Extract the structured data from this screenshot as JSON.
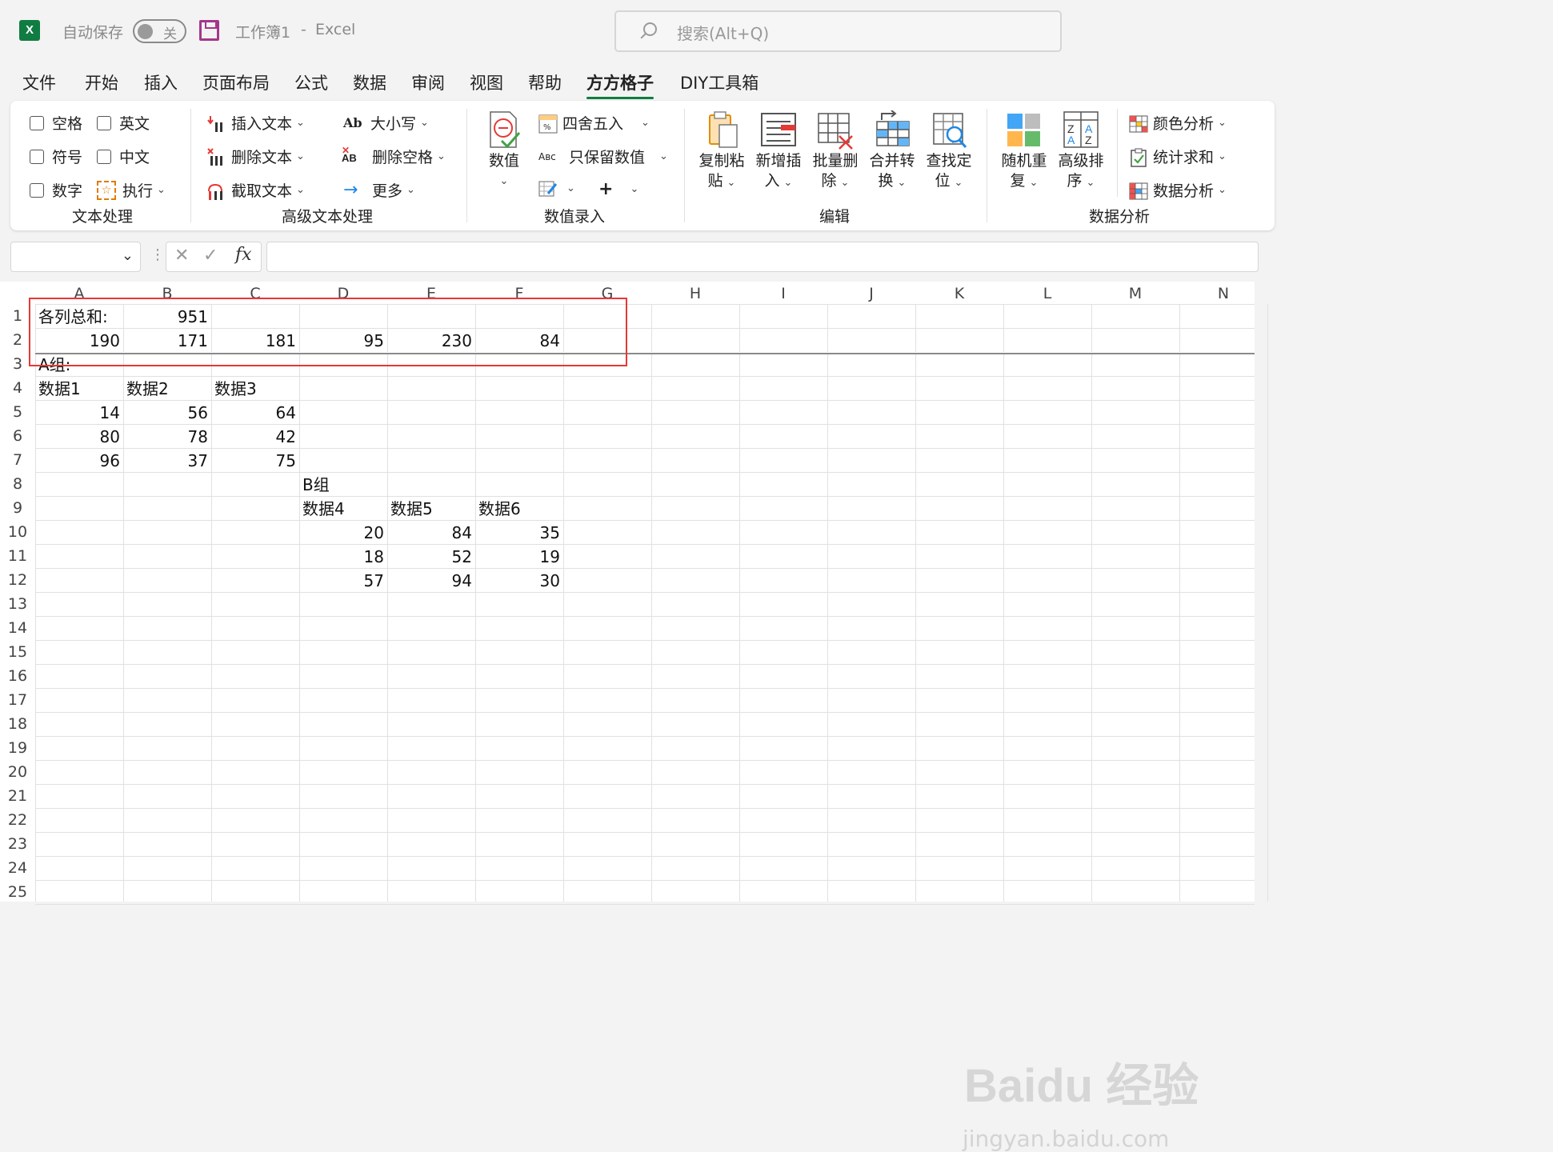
{
  "titlebar": {
    "autosave_label": "自动保存",
    "autosave_state": "关",
    "workbook_name": "工作簿1",
    "separator": "-",
    "app_name": "Excel",
    "search_placeholder": "搜索(Alt+Q)"
  },
  "menu": {
    "tabs": [
      "文件",
      "开始",
      "插入",
      "页面布局",
      "公式",
      "数据",
      "审阅",
      "视图",
      "帮助",
      "方方格子",
      "DIY工具箱"
    ],
    "active": "方方格子"
  },
  "ribbon": {
    "text_processing": {
      "label": "文本处理",
      "checkboxes": [
        "空格",
        "英文",
        "符号",
        "中文",
        "数字"
      ],
      "execute": "执行"
    },
    "advanced_text": {
      "label": "高级文本处理",
      "items": [
        "插入文本",
        "删除文本",
        "截取文本",
        "大小写",
        "删除空格",
        "更多"
      ]
    },
    "value_entry": {
      "label": "数值录入",
      "big": "数值",
      "items": [
        "四舍五入",
        "只保留数值"
      ]
    },
    "edit": {
      "label": "编辑",
      "buttons": [
        {
          "l1": "复制粘",
          "l2": "贴"
        },
        {
          "l1": "新增插",
          "l2": "入"
        },
        {
          "l1": "批量删",
          "l2": "除"
        },
        {
          "l1": "合并转",
          "l2": "换"
        },
        {
          "l1": "查找定",
          "l2": "位"
        }
      ]
    },
    "analysis": {
      "label": "数据分析",
      "buttons": [
        {
          "l1": "随机重",
          "l2": "复"
        },
        {
          "l1": "高级排",
          "l2": "序"
        }
      ],
      "items": [
        "颜色分析",
        "统计求和",
        "数据分析"
      ]
    }
  },
  "formula_bar": {
    "fx": "fx",
    "value": ""
  },
  "sheet": {
    "columns": [
      "A",
      "B",
      "C",
      "D",
      "E",
      "F",
      "G",
      "H",
      "I",
      "J",
      "K",
      "L",
      "M",
      "N"
    ],
    "rows": [
      "1",
      "2",
      "3",
      "4",
      "5",
      "6",
      "7",
      "8",
      "9",
      "10",
      "11",
      "12",
      "13",
      "14",
      "15",
      "16",
      "17",
      "18",
      "19",
      "20",
      "21",
      "22",
      "23",
      "24",
      "25"
    ],
    "cells": {
      "A1": "各列总和:",
      "B1": "951",
      "A2": "190",
      "B2": "171",
      "C2": "181",
      "D2": "95",
      "E2": "230",
      "F2": "84",
      "A3": "A组:",
      "A4": "数据1",
      "B4": "数据2",
      "C4": "数据3",
      "A5": "14",
      "B5": "56",
      "C5": "64",
      "A6": "80",
      "B6": "78",
      "C6": "42",
      "A7": "96",
      "B7": "37",
      "C7": "75",
      "D8": "B组",
      "D9": "数据4",
      "E9": "数据5",
      "F9": "数据6",
      "D10": "20",
      "E10": "84",
      "F10": "35",
      "D11": "18",
      "E11": "52",
      "F11": "19",
      "D12": "57",
      "E12": "94",
      "F12": "30"
    },
    "numeric_cells": [
      "B1",
      "A2",
      "B2",
      "C2",
      "D2",
      "E2",
      "F2",
      "A5",
      "B5",
      "C5",
      "A6",
      "B6",
      "C6",
      "A7",
      "B7",
      "C7",
      "D10",
      "E10",
      "F10",
      "D11",
      "E11",
      "F11",
      "D12",
      "E12",
      "F12"
    ]
  },
  "watermark": {
    "brand": "Baidu 经验",
    "url": "jingyan.baidu.com"
  }
}
